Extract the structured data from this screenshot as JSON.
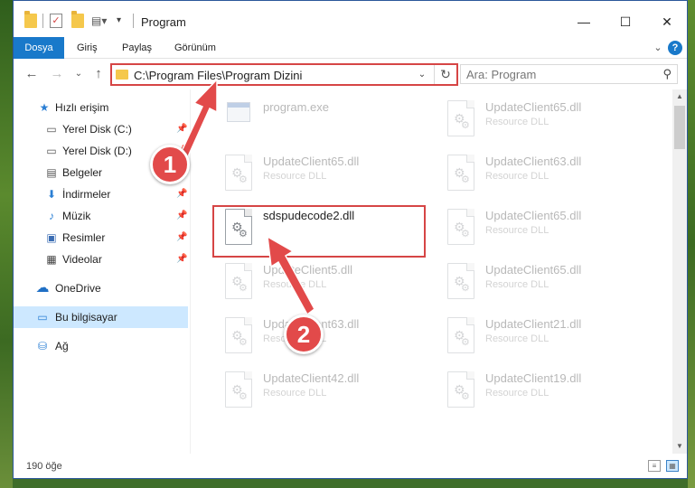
{
  "window": {
    "title": "Program",
    "minimize": "—",
    "maximize": "☐",
    "close": "✕"
  },
  "ribbon": {
    "tabs": [
      {
        "label": "Dosya",
        "active": true
      },
      {
        "label": "Giriş"
      },
      {
        "label": "Paylaş"
      },
      {
        "label": "Görünüm"
      }
    ],
    "expand_glyph": "⌄",
    "help_glyph": "?"
  },
  "nav": {
    "back_glyph": "←",
    "forward_glyph": "→",
    "recent_glyph": "⌄",
    "up_glyph": "↑",
    "address": "C:\\Program Files\\Program Dizini",
    "address_dropdown_glyph": "⌄",
    "refresh_glyph": "↻",
    "search_placeholder": "Ara: Program",
    "search_glyph": "⚲"
  },
  "sidebar": {
    "items": [
      {
        "label": "Hızlı erişim",
        "icon": "star-icon",
        "glyph": "★",
        "color": "#2b7fd4"
      },
      {
        "label": "Yerel Disk (C:)",
        "icon": "drive-icon",
        "glyph": "▭",
        "color": "#555555",
        "pin": "📌"
      },
      {
        "label": "Yerel Disk (D:)",
        "icon": "drive-icon",
        "glyph": "▭",
        "color": "#555555",
        "pin": "📌"
      },
      {
        "label": "Belgeler",
        "icon": "documents-icon",
        "glyph": "▤",
        "color": "#555555",
        "pin": "📌"
      },
      {
        "label": "İndirmeler",
        "icon": "download-icon",
        "glyph": "⬇",
        "color": "#2b7fd4",
        "pin": "📌"
      },
      {
        "label": "Müzik",
        "icon": "music-icon",
        "glyph": "♪",
        "color": "#2b7fd4",
        "pin": "📌"
      },
      {
        "label": "Resimler",
        "icon": "pictures-icon",
        "glyph": "▣",
        "color": "#3b6db3",
        "pin": "📌"
      },
      {
        "label": "Videolar",
        "icon": "videos-icon",
        "glyph": "▦",
        "color": "#444444",
        "pin": "📌"
      },
      {
        "label": "OneDrive",
        "icon": "cloud-icon",
        "glyph": "☁",
        "color": "#1f6fc5"
      },
      {
        "label": "Bu bilgisayar",
        "icon": "computer-icon",
        "glyph": "▭",
        "color": "#2b7fd4",
        "selected": true
      },
      {
        "label": "Ağ",
        "icon": "network-icon",
        "glyph": "⛁",
        "color": "#2b7fd4"
      }
    ]
  },
  "files": {
    "items": [
      {
        "name": "program.exe",
        "type": ""
      },
      {
        "name": "UpdateClient65.dll",
        "type": "Resource DLL"
      },
      {
        "name": "UpdateClient65.dll",
        "type": "Resource DLL"
      },
      {
        "name": "UpdateClient63.dll",
        "type": "Resource DLL"
      },
      {
        "name": "sdspudecode2.dll",
        "type": ""
      },
      {
        "name": "UpdateClient65.dll",
        "type": "Resource DLL"
      },
      {
        "name": "UpdateClient5.dll",
        "type": "Resource DLL"
      },
      {
        "name": "UpdateClient65.dll",
        "type": "Resource DLL"
      },
      {
        "name": "UpdateClient63.dll",
        "type": "Resource DLL"
      },
      {
        "name": "UpdateClient21.dll",
        "type": "Resource DLL"
      },
      {
        "name": "UpdateClient42.dll",
        "type": "Resource DLL"
      },
      {
        "name": "UpdateClient19.dll",
        "type": "Resource DLL"
      }
    ]
  },
  "status": {
    "count": "190 öğe"
  },
  "annotations": {
    "badge_1": "1",
    "badge_2": "2",
    "color": "#e24a4a"
  }
}
